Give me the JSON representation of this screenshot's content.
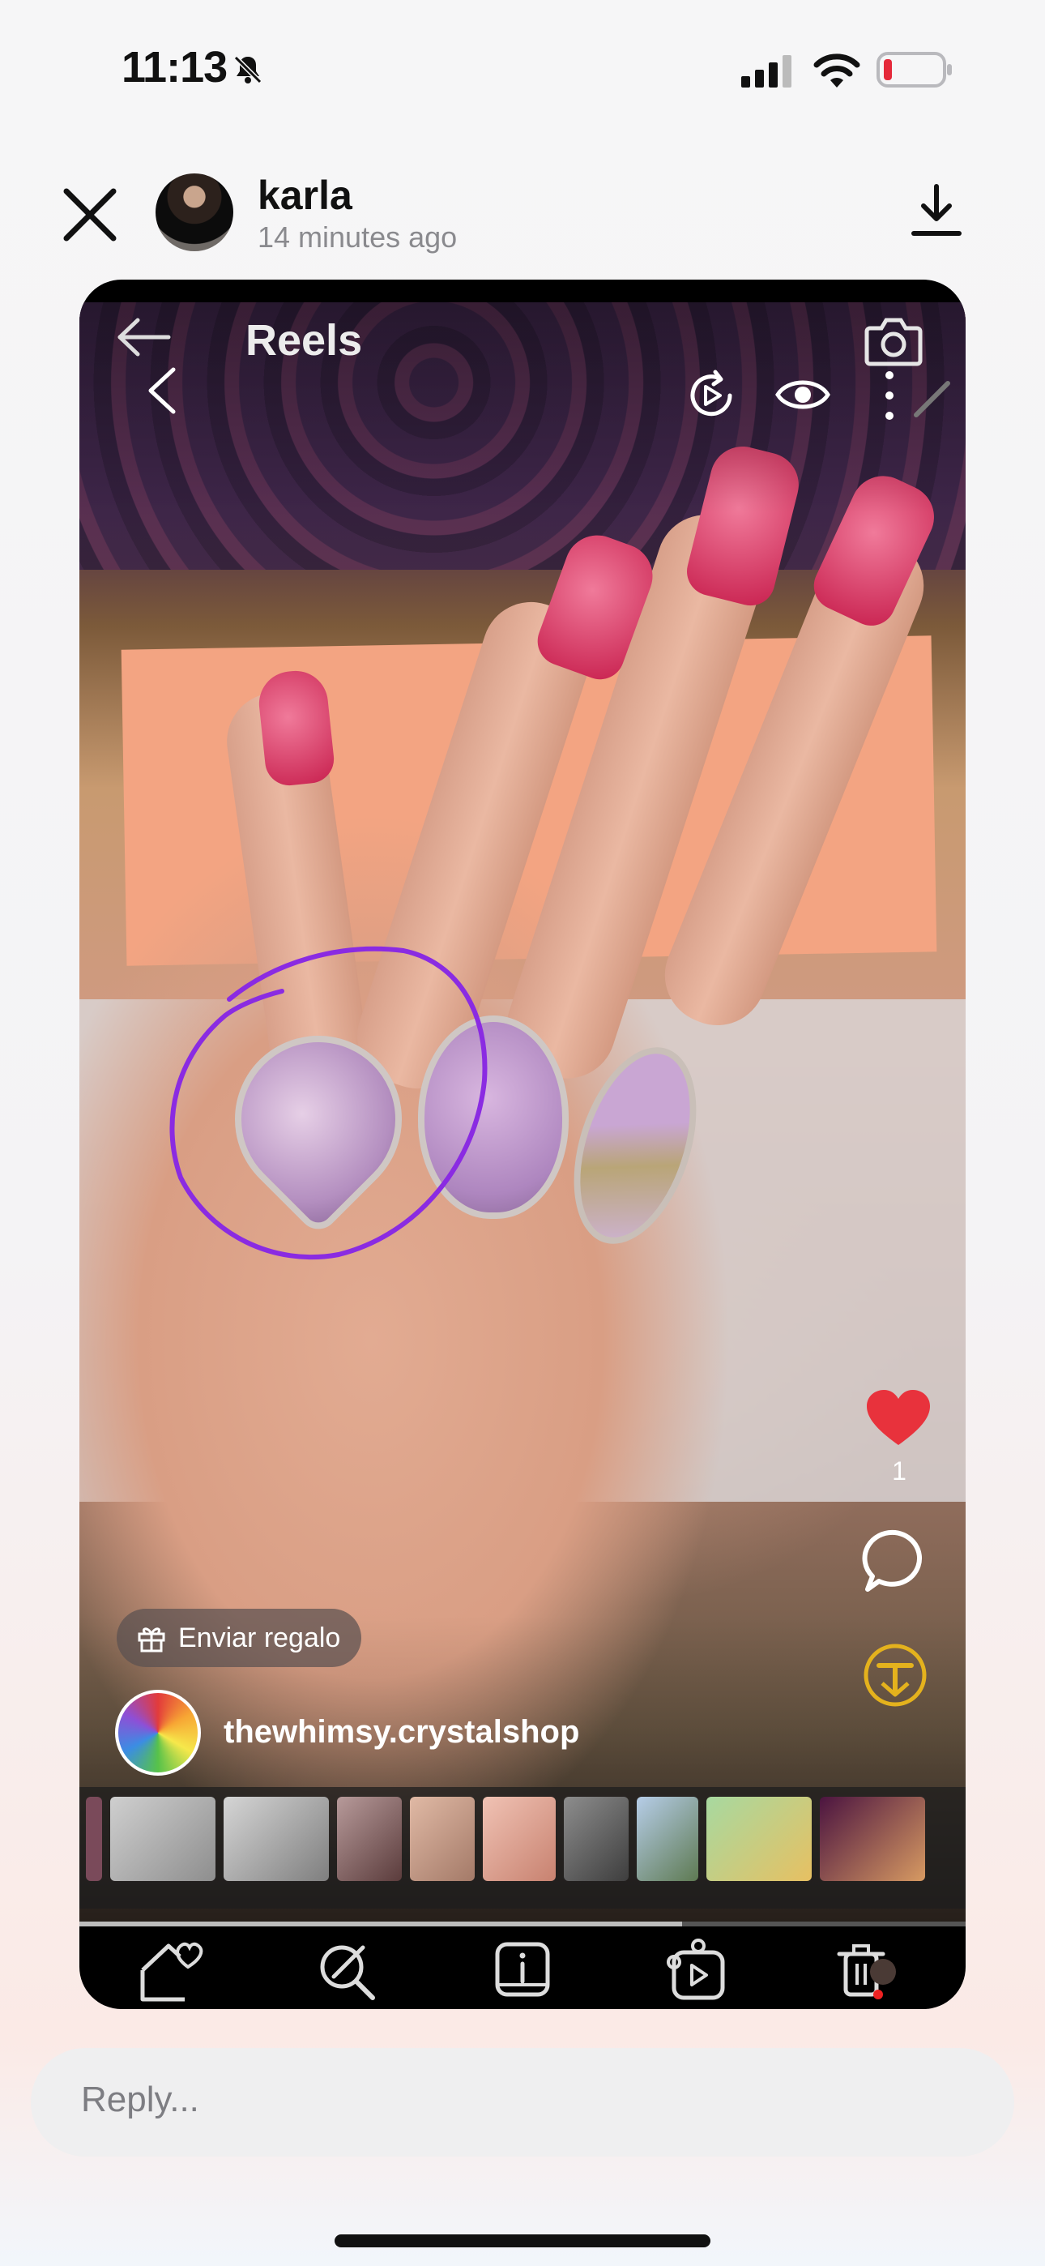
{
  "status_bar": {
    "time": "11:13",
    "icons": [
      "bell-slash-icon",
      "cellular-signal-icon",
      "wifi-icon",
      "battery-low-icon"
    ]
  },
  "header": {
    "username": "karla",
    "timestamp": "14 minutes ago"
  },
  "reels": {
    "title": "Reels"
  },
  "actions": {
    "like_count": "1"
  },
  "post": {
    "gift_label": "Enviar regalo",
    "account": "thewhimsy.crystalshop"
  },
  "progress": {
    "fraction": 0.68
  },
  "reply": {
    "placeholder": "Reply..."
  },
  "colors": {
    "like_red": "#e8323c",
    "annotation_purple": "#8a2be2",
    "gold": "#e4b21d"
  }
}
